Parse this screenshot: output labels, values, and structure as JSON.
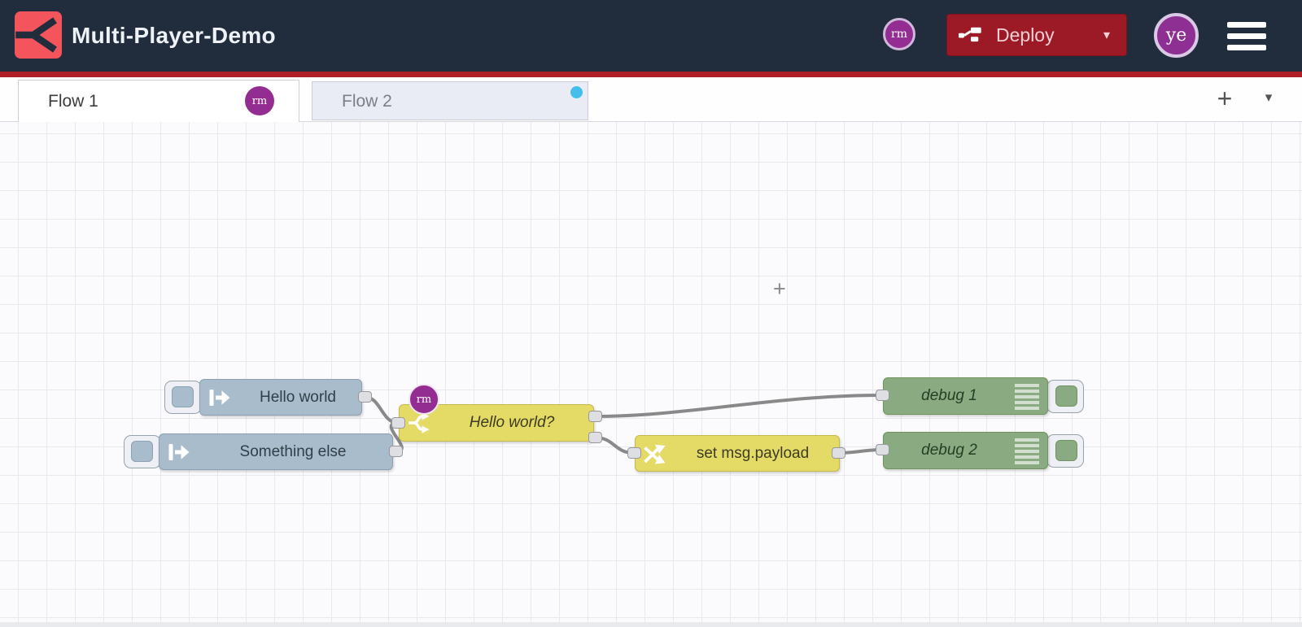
{
  "header": {
    "title": "Multi-Player-Demo",
    "deploy_label": "Deploy",
    "deploy_caret": "▾",
    "collaborator_badge": "rm",
    "user_avatar": "ye"
  },
  "tabs": {
    "flow1": {
      "label": "Flow 1",
      "collaborator_badge": "rm",
      "active": true
    },
    "flow2": {
      "label": "Flow 2",
      "active": false,
      "has_activity_dot": true
    },
    "add_button": "+",
    "list_caret": "▾"
  },
  "flow": {
    "nodes": {
      "inject_hello": {
        "type": "inject",
        "label": "Hello world"
      },
      "inject_something": {
        "type": "inject",
        "label": "Something else"
      },
      "switch_hello": {
        "type": "switch",
        "label": "Hello world?",
        "collaborator_badge": "rm",
        "outputs": 2
      },
      "change_set": {
        "type": "change",
        "label": "set msg.payload"
      },
      "debug1": {
        "type": "debug",
        "label": "debug 1"
      },
      "debug2": {
        "type": "debug",
        "label": "debug 2"
      }
    },
    "wires": [
      {
        "from": "inject_hello",
        "to": "switch_hello"
      },
      {
        "from": "inject_something",
        "to": "switch_hello"
      },
      {
        "from": "switch_hello",
        "from_output": 1,
        "to": "debug1"
      },
      {
        "from": "switch_hello",
        "from_output": 2,
        "to": "change_set"
      },
      {
        "from": "change_set",
        "to": "debug2"
      }
    ]
  },
  "canvas": {
    "cursor_glyph": "+"
  },
  "colors": {
    "header_bg": "#212d3d",
    "accent_red_divider": "#b01e28",
    "deploy_red": "#9b1a26",
    "collaborator_purple": "#942d92",
    "inject_node": "#a8bccc",
    "function_node_yellow": "#e4da66",
    "debug_node_green": "#8aab81",
    "wire_grey": "#898989",
    "activity_dot_blue": "#43bfee",
    "logo_red": "#f4545c"
  }
}
